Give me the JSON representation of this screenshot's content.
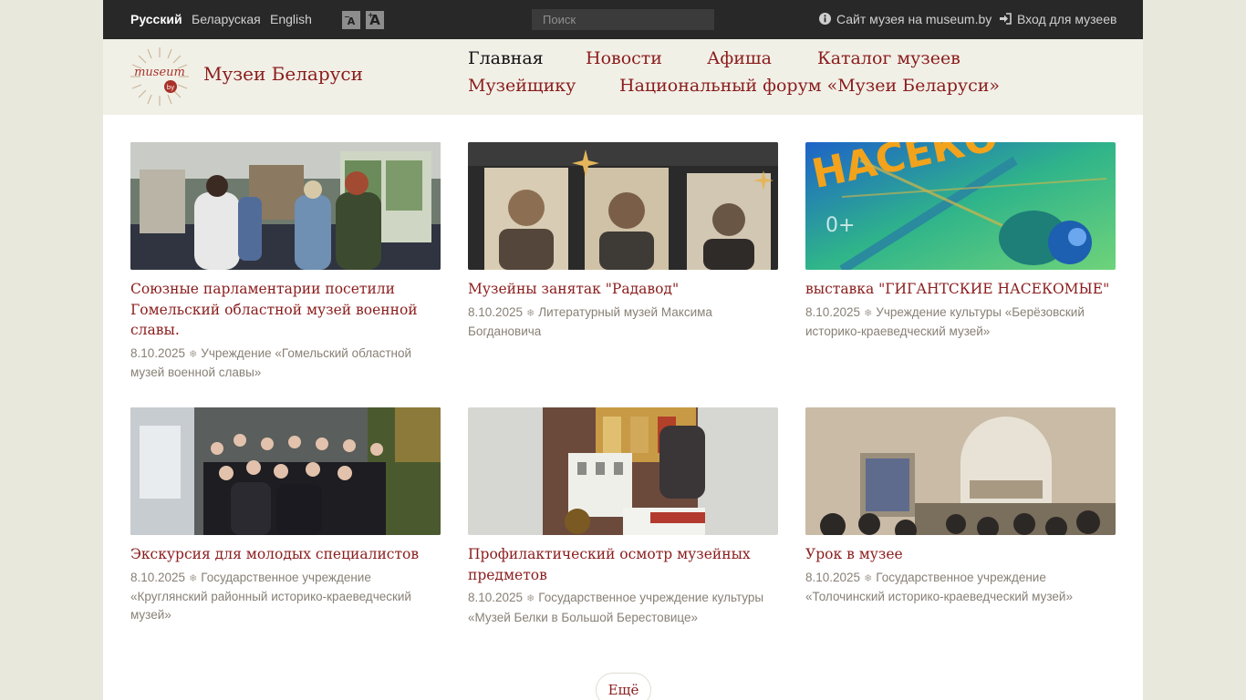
{
  "topbar": {
    "languages": [
      "Русский",
      "Беларуская",
      "English"
    ],
    "font_small": "A",
    "font_large": "A",
    "search_placeholder": "Поиск",
    "museum_site_link": "Сайт музея на museum.by",
    "login_link": "Вход для музеев",
    "icons": [
      "info-circle-icon",
      "sign-in-icon"
    ]
  },
  "header": {
    "logo_text": "museum by",
    "site_title": "Музеи Беларуси",
    "nav": [
      "Главная",
      "Новости",
      "Афиша",
      "Каталог музеев",
      "Музейщику",
      "Национальный форум «Музеи Беларуси»"
    ],
    "active_nav": "Главная"
  },
  "colors": {
    "accent": "#8a1c1c",
    "topbar_bg": "#282828",
    "header_bg": "#f1f0e7",
    "body_bg": "#e9e8dd",
    "meta_text": "#888076"
  },
  "news": [
    {
      "title": "Союзные парламентарии посетили Гомельский областной музей военной славы.",
      "date": "8.10.2025",
      "source": "Учреждение «Гомельский областной музей военной славы»",
      "image": "group-visiting-museum-exhibition-photo"
    },
    {
      "title": "Музейны занятак \"Радавод\"",
      "date": "8.10.2025",
      "source": "Литературный музей Максима Богдановича",
      "image": "vintage-portrait-photos"
    },
    {
      "title": "выставка \"ГИГАНТСКИЕ НАСЕКОМЫЕ\"",
      "date": "8.10.2025",
      "source": "Учреждение культуры «Берёзовский историко-краеведческий музей»",
      "image": "dragonfly-poster",
      "image_text": [
        "НАСЕКО",
        "0+"
      ]
    },
    {
      "title": "Экскурсия для молодых специалистов",
      "date": "8.10.2025",
      "source": "Государственное учреждение «Круглянский районный историко-краеведческий музей»",
      "image": "group-photo-outdoors"
    },
    {
      "title": "Профилактический осмотр музейных предметов",
      "date": "8.10.2025",
      "source": "Государственное учреждение культуры «Музей Белки в Большой Берестовице»",
      "image": "museum-items-inspection-photo"
    },
    {
      "title": "Урок в музее",
      "date": "8.10.2025",
      "source": "Государственное учреждение «Толочинский историко-краеведческий музей»",
      "image": "museum-lesson-photo"
    }
  ],
  "more_button": "Ещё",
  "separator": "❄"
}
